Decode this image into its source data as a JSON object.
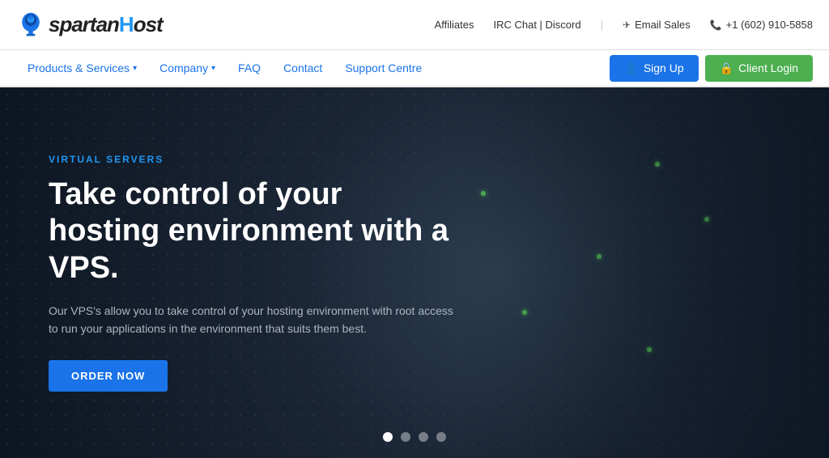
{
  "header": {
    "logo": "spartanHost",
    "top_links": {
      "affiliates": "Affiliates",
      "irc": "IRC Chat | Discord",
      "email": "Email Sales",
      "phone": "+1 (602) 910-5858"
    }
  },
  "nav": {
    "links": [
      {
        "label": "Products & Services",
        "has_dropdown": true
      },
      {
        "label": "Company",
        "has_dropdown": true
      },
      {
        "label": "FAQ",
        "has_dropdown": false
      },
      {
        "label": "Contact",
        "has_dropdown": false
      },
      {
        "label": "Support Centre",
        "has_dropdown": false
      }
    ],
    "signup_label": "Sign Up",
    "login_label": "Client Login"
  },
  "hero": {
    "category": "VIRTUAL SERVERS",
    "title": "Take control of your hosting environment with a VPS.",
    "description": "Our VPS's allow you to take control of your hosting environment with root access to run your applications in the environment that suits them best.",
    "cta_label": "ORDER NOW",
    "slider_dots": [
      {
        "active": true
      },
      {
        "active": false
      },
      {
        "active": false
      },
      {
        "active": false
      }
    ]
  },
  "colors": {
    "blue": "#1a73e8",
    "green": "#4caf50",
    "nav_link": "#1a73e8",
    "hero_bg": "#1a2535"
  }
}
